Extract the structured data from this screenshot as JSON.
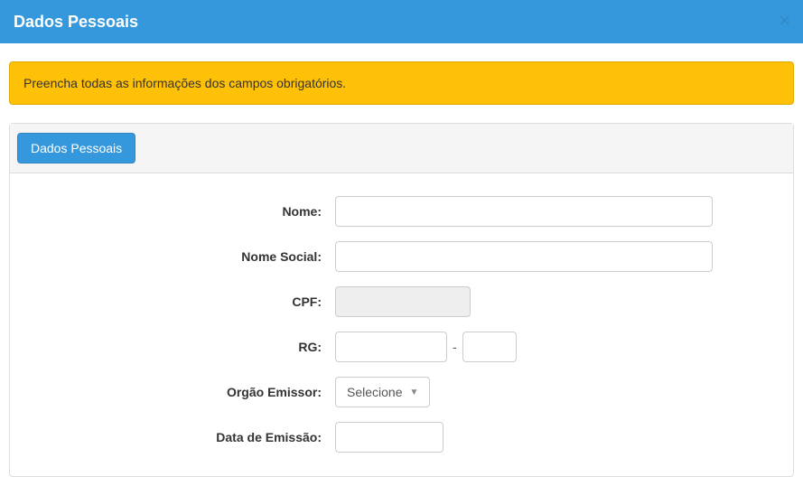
{
  "modal": {
    "title": "Dados Pessoais",
    "close_glyph": "×"
  },
  "alert": {
    "message": "Preencha todas as informações dos campos obrigatórios."
  },
  "tabs": {
    "dados_pessoais": "Dados Pessoais"
  },
  "form": {
    "nome": {
      "label": "Nome:",
      "value": ""
    },
    "nome_social": {
      "label": "Nome Social:",
      "value": ""
    },
    "cpf": {
      "label": "CPF:",
      "value": ""
    },
    "rg": {
      "label": "RG:",
      "value": "",
      "dash": "-",
      "digit": ""
    },
    "orgao_emissor": {
      "label": "Orgão Emissor:",
      "selected": "Selecione"
    },
    "data_emissao": {
      "label": "Data de Emissão:",
      "value": ""
    }
  }
}
